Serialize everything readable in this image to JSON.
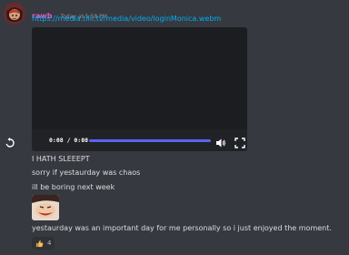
{
  "message": {
    "username": "rawb",
    "timestamp": "Today at 5:58 PM",
    "link": "https://media.tilii.tv/media/video/loginMonica.webm"
  },
  "video_player": {
    "time": "0:08 / 0:08",
    "progress": 1.0
  },
  "lines": [
    "I HATH SLEEEPT",
    "sorry if yestaurday was chaos",
    "ill be boring next week",
    "yestaurday was an important day for me personally so i just enjoyed the moment."
  ],
  "reaction": {
    "emoji": "thumbs-up",
    "count": "4"
  },
  "colors": {
    "background": "#36393f",
    "username": "#e05cc0",
    "link": "#00aff4",
    "progress": "#5865f2"
  }
}
